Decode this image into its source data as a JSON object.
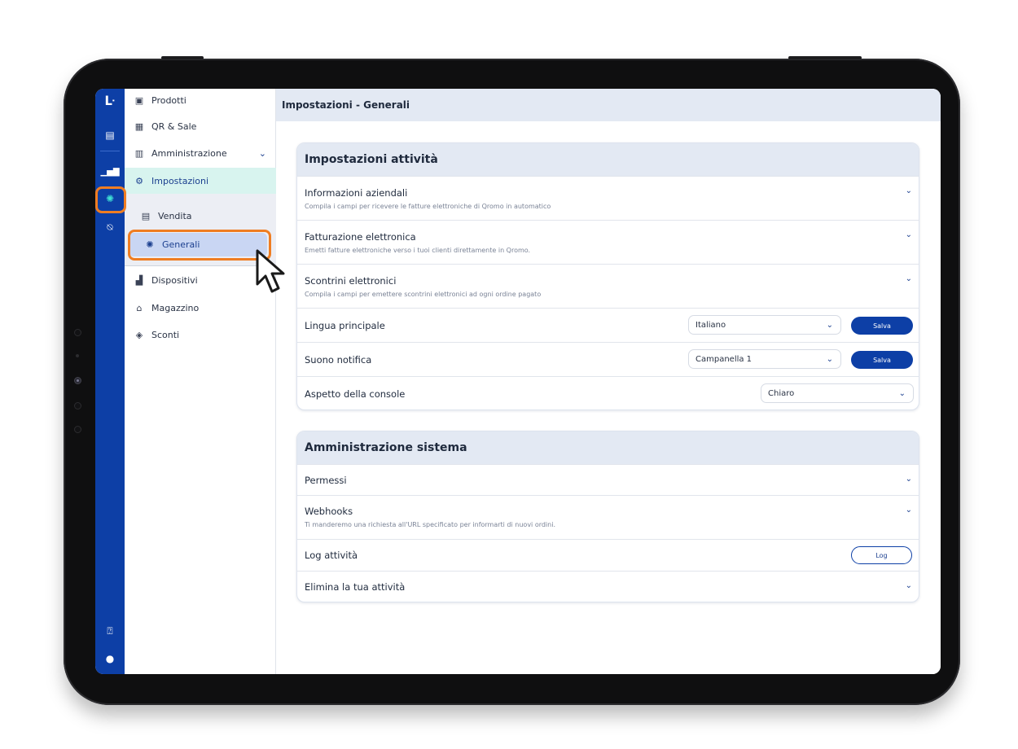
{
  "rail": {
    "icons": [
      "logo-icon",
      "receipt-icon",
      "chart-icon",
      "settings-icon",
      "store-icon",
      "help-icon",
      "user-icon"
    ]
  },
  "menu": {
    "items": [
      {
        "label": "Prodotti",
        "icon": "menu-book-icon"
      },
      {
        "label": "QR & Sale",
        "icon": "qr-icon"
      },
      {
        "label": "Amministrazione",
        "icon": "admin-icon"
      },
      {
        "label": "Impostazioni",
        "icon": "settings-icon"
      },
      {
        "label": "Vendita",
        "icon": "register-icon"
      },
      {
        "label": "Generali",
        "icon": "gear-icon"
      },
      {
        "label": "Dispositivi",
        "icon": "devices-icon"
      },
      {
        "label": "Magazzino",
        "icon": "warehouse-icon"
      },
      {
        "label": "Sconti",
        "icon": "tag-icon"
      }
    ]
  },
  "header": {
    "title": "Impostazioni - Generali"
  },
  "activity_settings": {
    "title": "Impostazioni attività",
    "rows": [
      {
        "label": "Informazioni aziendali",
        "desc": "Compila i campi per ricevere le fatture elettroniche di Qromo in automatico"
      },
      {
        "label": "Fatturazione elettronica",
        "desc": "Emetti fatture elettroniche verso i tuoi clienti direttamente in Qromo."
      },
      {
        "label": "Scontrini elettronici",
        "desc": "Compila i campi per emettere scontrini elettronici ad ogni ordine pagato"
      }
    ],
    "language": {
      "label": "Lingua principale",
      "value": "Italiano",
      "save": "Salva"
    },
    "notification": {
      "label": "Suono notifica",
      "value": "Campanella 1",
      "save": "Salva"
    },
    "appearance": {
      "label": "Aspetto della console",
      "value": "Chiaro"
    }
  },
  "system_admin": {
    "title": "Amministrazione sistema",
    "permissions": {
      "label": "Permessi"
    },
    "webhooks": {
      "label": "Webhooks",
      "desc": "Ti manderemo una richiesta all'URL specificato per informarti di nuovi ordini."
    },
    "log": {
      "label": "Log attività",
      "button": "Log"
    },
    "delete": {
      "label": "Elimina la tua attività"
    }
  },
  "colors": {
    "accent": "#0d3fa6",
    "highlight": "#ef7d22",
    "teal": "#3fe0d4"
  }
}
